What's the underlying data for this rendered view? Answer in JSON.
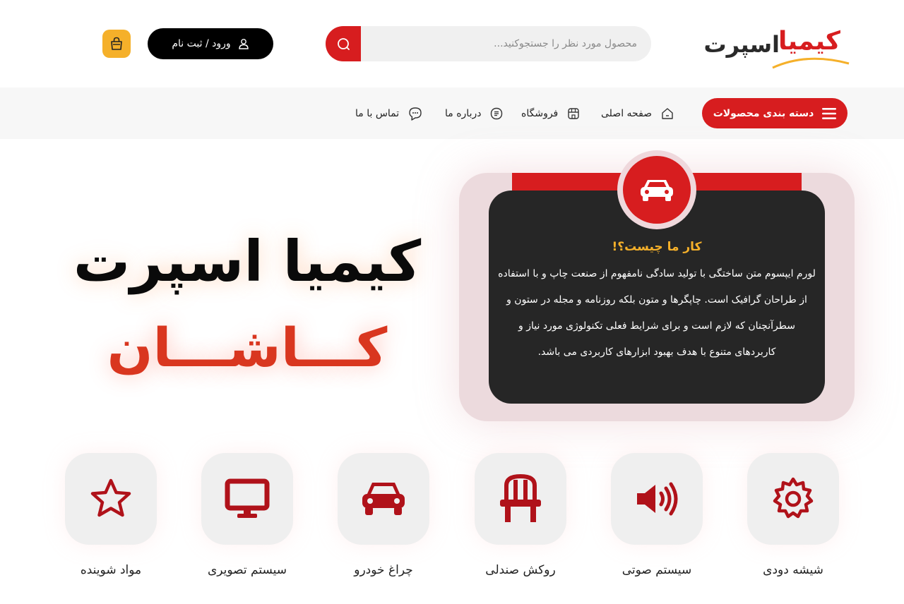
{
  "header": {
    "logo_part1": "کیمیا",
    "logo_part2": "اسپرت",
    "search_placeholder": "محصول مورد نظر را جستجوکنید...",
    "login_label": "ورود / ثبت نام"
  },
  "nav": {
    "category_button": "دسته بندی محصولات",
    "items": [
      {
        "label": "صفحه اصلی",
        "icon": "home-icon"
      },
      {
        "label": "فروشگاه",
        "icon": "store-icon"
      },
      {
        "label": "درباره ما",
        "icon": "info-icon"
      },
      {
        "label": "تماس با ما",
        "icon": "chat-icon"
      }
    ]
  },
  "hero": {
    "title": "کیمیا اسپرت",
    "city": "کـــاشـــان"
  },
  "info_card": {
    "title": "کار ما چیست؟!",
    "text": "لورم ایپسوم متن ساختگی با تولید سادگی نامفهوم از صنعت چاپ و با استفاده از طراحان گرافیک است. چاپگرها و متون بلکه روزنامه و مجله در ستون و سطرآنچنان که لازم است و برای شرایط فعلی تکنولوژی مورد نیاز و کاربردهای متنوع با هدف بهبود ابزارهای کاربردی می باشد."
  },
  "categories": [
    {
      "label": "شیشه دودی",
      "icon": "gear-icon"
    },
    {
      "label": "سیستم صوتی",
      "icon": "speaker-icon"
    },
    {
      "label": "روکش صندلی",
      "icon": "chair-icon"
    },
    {
      "label": "چراغ خودرو",
      "icon": "car-icon"
    },
    {
      "label": "سیستم تصویری",
      "icon": "monitor-icon"
    },
    {
      "label": "مواد شوینده",
      "icon": "star-icon"
    }
  ],
  "colors": {
    "brand_red": "#d71d1f",
    "accent_yellow": "#f5b02a",
    "dark": "#262626"
  }
}
